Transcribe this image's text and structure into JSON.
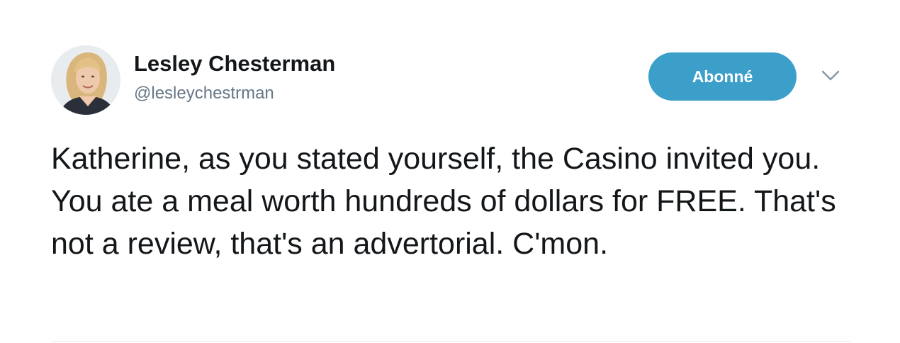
{
  "tweet": {
    "author": {
      "display_name": "Lesley Chesterman",
      "handle": "@lesleychestrman",
      "avatar_icon": "profile-photo"
    },
    "follow_button_label": "Abonné",
    "menu_icon": "chevron-down-icon",
    "text": "Katherine, as you stated yourself, the Casino invited you. You ate a meal worth hundreds of dollars for FREE. That's not a review, that's an advertorial. C'mon."
  },
  "colors": {
    "follow_button": "#3c9fca",
    "handle": "#657786",
    "text": "#14171a"
  }
}
